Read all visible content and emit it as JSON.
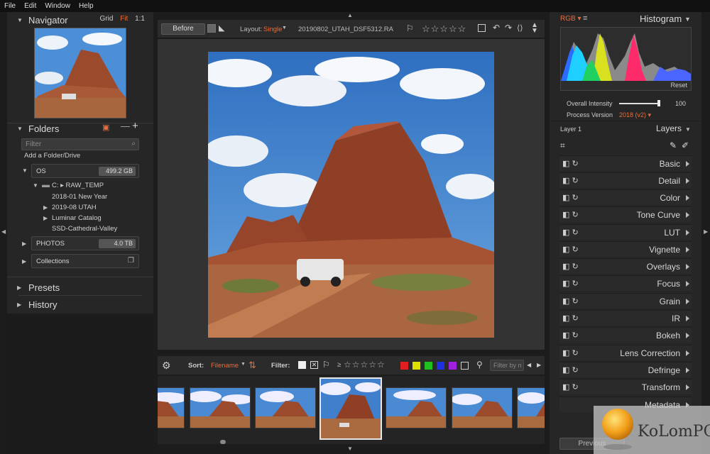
{
  "menu": [
    "File",
    "Edit",
    "Window",
    "Help"
  ],
  "navigator": {
    "title": "Navigator",
    "options": [
      "Grid",
      "Fit",
      "1:1"
    ],
    "active_option": "Fit"
  },
  "folders": {
    "title": "Folders",
    "filter_placeholder": "Filter",
    "add_label": "Add a Folder/Drive",
    "drives": [
      {
        "label": "OS",
        "size": "499.2 GB"
      },
      {
        "label": "PHOTOS",
        "size": "4.0 TB"
      },
      {
        "label": "Collections",
        "size": ""
      }
    ],
    "tree_path": "C: ▸ RAW_TEMP",
    "tree_items": [
      "2018-01 New Year",
      "2019-08 UTAH",
      "Luminar Catalog",
      "SSD-Cathedral-Valley"
    ]
  },
  "presets_title": "Presets",
  "history_title": "History",
  "toolbar": {
    "before_label": "Before",
    "layout_label": "Layout:",
    "layout_value": "Single",
    "filename": "20190802_UTAH_DSF5312.RA"
  },
  "filmbar": {
    "sort_label": "Sort:",
    "sort_value": "Filename",
    "filter_label": "Filter:",
    "filter_placeholder": "Filter by n",
    "compare": "≥",
    "swatches": [
      "#e02020",
      "#e0e000",
      "#20c020",
      "#2030e0",
      "#a020e0"
    ]
  },
  "histogram": {
    "channel": "RGB",
    "title": "Histogram",
    "reset_label": "Reset"
  },
  "canvas_settings": {
    "intensity_label": "Overall Intensity",
    "intensity_value": "100",
    "process_label": "Process Version",
    "process_value": "2018 (v2)"
  },
  "layers": {
    "layer_name": "Layer 1",
    "title": "Layers",
    "filters": [
      "Basic",
      "Detail",
      "Color",
      "Tone Curve",
      "LUT",
      "Vignette",
      "Overlays",
      "Focus",
      "Grain",
      "IR",
      "Bokeh",
      "Lens Correction",
      "Defringe",
      "Transform",
      "Metadata"
    ]
  },
  "bottom": {
    "previous_label": "Previous",
    "watermark_text": "KoLomPC"
  },
  "colors": {
    "accent": "#e86d3a",
    "panel": "#262626",
    "background": "#1c1c1c"
  }
}
